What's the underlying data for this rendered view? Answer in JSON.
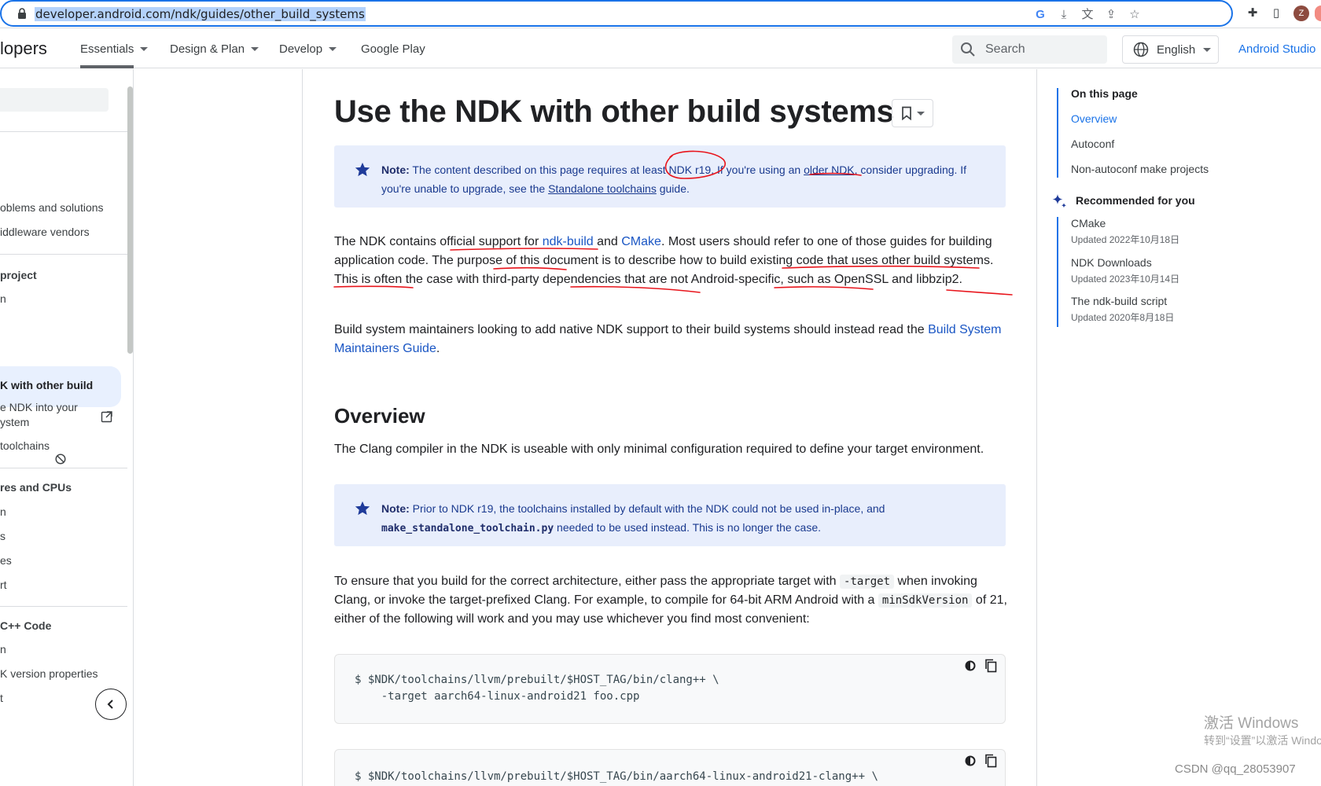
{
  "browser": {
    "url": "developer.android.com/ndk/guides/other_build_systems",
    "profile_initial": "Z"
  },
  "header": {
    "brand_fragment": "lopers",
    "nav": [
      {
        "label": "Essentials",
        "dropdown": true
      },
      {
        "label": "Design & Plan",
        "dropdown": true
      },
      {
        "label": "Develop",
        "dropdown": true
      },
      {
        "label": "Google Play",
        "dropdown": false
      }
    ],
    "search_placeholder": "Search",
    "language": "English",
    "studio_link": "Android Studio"
  },
  "sidebar": {
    "items": [
      {
        "label": "oblems and solutions"
      },
      {
        "label": "iddleware vendors"
      },
      {
        "label": "project",
        "heading": true
      },
      {
        "label": "n"
      },
      {
        "label": "K with other build",
        "active": true
      },
      {
        "label": "e NDK into your"
      },
      {
        "label": "ystem"
      },
      {
        "label": "toolchains"
      },
      {
        "label": "res and CPUs",
        "heading": true
      },
      {
        "label": "n"
      },
      {
        "label": "s"
      },
      {
        "label": "es"
      },
      {
        "label": "rt"
      },
      {
        "label": "C++ Code",
        "heading": true
      },
      {
        "label": "n"
      },
      {
        "label": "K version properties"
      },
      {
        "label": "t"
      }
    ]
  },
  "article": {
    "title": "Use the NDK with other build systems",
    "note1": {
      "label": "Note:",
      "t1": " The content described on this page requires at least ",
      "link1": "NDK r19",
      "t2": ". If you're using an ",
      "link2": "older NDK",
      "t3": ", consider upgrading. If you're unable to upgrade, see the ",
      "link3": "Standalone toolchains",
      "t4": " guide."
    },
    "p1": {
      "t1": "The NDK contains official support for ",
      "link1": "ndk-build",
      "t2": " and ",
      "link2": "CMake",
      "t3": ". Most users should refer to one of those guides for building application code. The purpose of this document is to describe how to build existing code that uses other build systems. This is often the case with third-party dependencies that are not Android-specific, such as OpenSSL and libbzip2."
    },
    "p2": {
      "t1": "Build system maintainers looking to add native NDK support to their build systems should instead read the ",
      "link1": "Build System Maintainers Guide",
      "t2": "."
    },
    "overview_heading": "Overview",
    "p3": "The Clang compiler in the NDK is useable with only minimal configuration required to define your target environment.",
    "note2": {
      "label": "Note:",
      "t1": " Prior to NDK r19, the toolchains installed by default with the NDK could not be used in-place, and ",
      "code": "make_standalone_toolchain.py",
      "t2": " needed to be used instead. This is no longer the case."
    },
    "p4": {
      "t1": "To ensure that you build for the correct architecture, either pass the appropriate target with ",
      "code1": "-target",
      "t2": " when invoking Clang, or invoke the target-prefixed Clang. For example, to compile for 64-bit ARM Android with a ",
      "code2": "minSdkVersion",
      "t3": " of 21, either of the following will work and you may use whichever you find most convenient:"
    },
    "code1": "$ $NDK/toolchains/llvm/prebuilt/$HOST_TAG/bin/clang++ \\\n    -target aarch64-linux-android21 foo.cpp",
    "code2": "$ $NDK/toolchains/llvm/prebuilt/$HOST_TAG/bin/aarch64-linux-android21-clang++ \\"
  },
  "toc": {
    "title": "On this page",
    "items": [
      "Overview",
      "Autoconf",
      "Non-autoconf make projects"
    ],
    "recommended_title": "Recommended for you",
    "recommended": [
      {
        "title": "CMake",
        "date": "Updated 2022年10月18日"
      },
      {
        "title": "NDK Downloads",
        "date": "Updated 2023年10月14日"
      },
      {
        "title": "The ndk-build script",
        "date": "Updated 2020年8月18日"
      }
    ]
  },
  "overlays": {
    "windows_line1": "激活 Windows",
    "windows_line2": "转到“设置”以激活 Windows。",
    "watermark": "CSDN @qq_28053907"
  },
  "colors": {
    "accent": "#1a73e8",
    "note_bg": "#e8eefc",
    "annotation_ink": "#e8141b"
  }
}
